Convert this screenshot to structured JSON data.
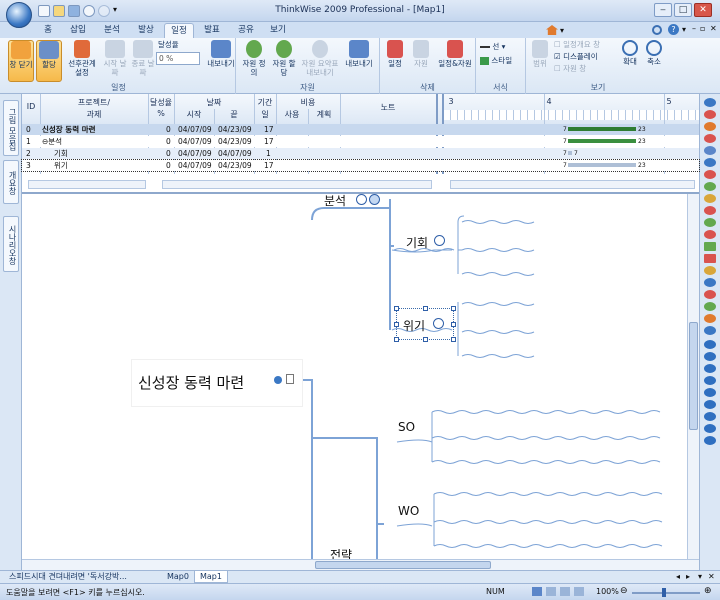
{
  "app": {
    "title": "ThinkWise 2009 Professional - [Map1]"
  },
  "ribbon_tabs": [
    "홈",
    "삽입",
    "분석",
    "발상",
    "일정",
    "발표",
    "공유",
    "보기"
  ],
  "active_tab": "일정",
  "ribbon": {
    "groups": {
      "schedule": "일정",
      "resource": "자원",
      "delete": "삭제",
      "format": "서식",
      "view": "보기"
    },
    "buttons": {
      "close_bar": "창 닫기",
      "assign": "할당",
      "predecessor": "선후관계 설정",
      "start_date": "시작 날짜",
      "end_date": "종료 날짜",
      "progress": "달성율",
      "progress_value": "0 %",
      "export1": "내보내기",
      "resource_define": "자원 정의",
      "resource_assign": "자원 할당",
      "resource_summary": "자원 요약표 내보내기",
      "export2": "내보내기",
      "del_schedule": "일정",
      "del_resource": "자원",
      "del_both": "일정&자원",
      "line": "선",
      "style": "스타일",
      "range": "범위",
      "schedule_summary_window": "일정개요 창",
      "display": "디스플레이",
      "resource_window": "자원 창",
      "zoom_in": "확대",
      "zoom_out": "축소"
    }
  },
  "left_tabs": [
    "그림 모음집",
    "개요창",
    "시나리오창"
  ],
  "gantt": {
    "headers": {
      "id": "ID",
      "project": "프로젝트/",
      "task": "과제",
      "progress": "달성율",
      "progress_unit": "%",
      "date": "날짜",
      "start": "시작",
      "end": "끝",
      "duration": "기간",
      "duration_unit": "일",
      "cost": "비용",
      "cost_used": "사용",
      "cost_plan": "계획",
      "note": "노트"
    },
    "timeline_numbers": [
      "3",
      "4",
      "5"
    ],
    "rows": [
      {
        "id": "0",
        "name": "신성장 동력 마련",
        "progress": "0",
        "start": "04/07/09",
        "end": "04/23/09",
        "days": "17",
        "bar_left": "7",
        "bar_right": "23"
      },
      {
        "id": "1",
        "name": "⊖분석",
        "progress": "0",
        "start": "04/07/09",
        "end": "04/23/09",
        "days": "17",
        "bar_left": "7",
        "bar_right": "23"
      },
      {
        "id": "2",
        "name": "기회",
        "progress": "0",
        "start": "04/07/09",
        "end": "04/07/09",
        "days": "1",
        "bar_left": "7",
        "bar_right": "7"
      },
      {
        "id": "3",
        "name": "위기",
        "progress": "0",
        "start": "04/07/09",
        "end": "04/23/09",
        "days": "17",
        "bar_left": "7",
        "bar_right": "23"
      }
    ]
  },
  "map": {
    "central": "신성장 동력 마련",
    "branch_analysis": "분석",
    "opportunity": "기회",
    "threat": "위기",
    "so": "SO",
    "wo": "WO",
    "strategy": "전략"
  },
  "doc_tabs": [
    "스피드시대 견뎌내려면 '독서강박...",
    "Map0",
    "Map1"
  ],
  "active_doc_tab": "Map1",
  "status": {
    "help": "도움말을 보려면 <F1> 키를 누르십시오.",
    "num": "NUM",
    "zoom": "100%"
  }
}
